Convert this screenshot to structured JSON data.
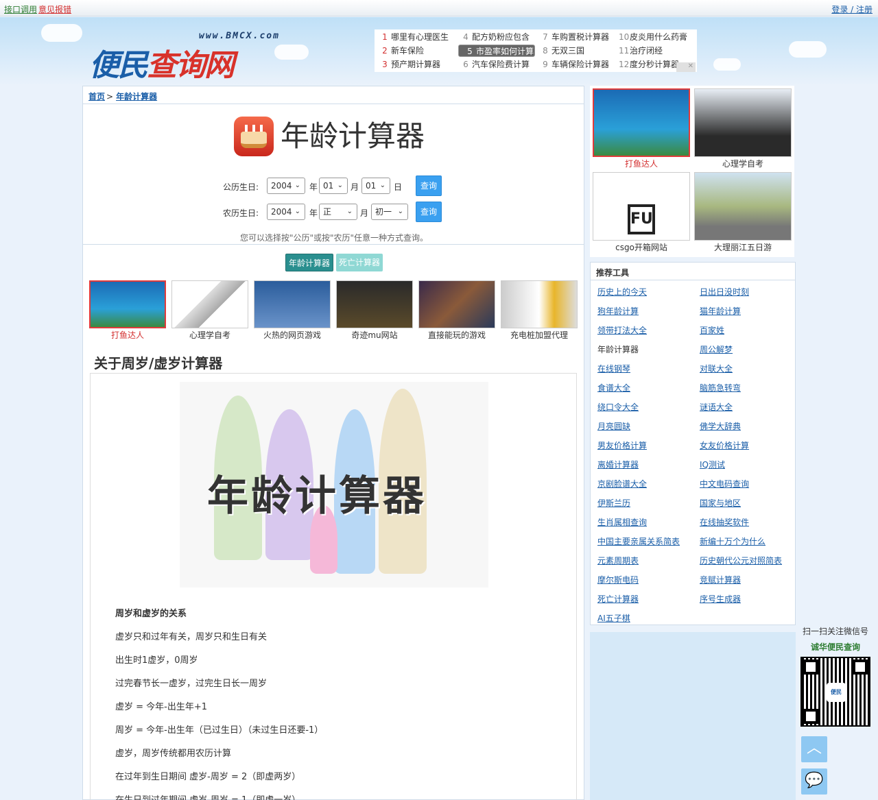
{
  "topbar": {
    "api_link": "接口调用",
    "feedback_link": "意见报错",
    "auth_link": "登录 / 注册"
  },
  "logo": {
    "site": "www.BMCX.com",
    "name_part1": "便民",
    "name_part2": "查询网"
  },
  "hot_list": [
    {
      "n": "1",
      "text": "哪里有心理医生"
    },
    {
      "n": "2",
      "text": "新车保险"
    },
    {
      "n": "3",
      "text": "预产期计算器"
    },
    {
      "n": "4",
      "text": "配方奶粉应包含"
    },
    {
      "n": "5",
      "text": "市盈率如何计算"
    },
    {
      "n": "6",
      "text": "汽车保险费计算"
    },
    {
      "n": "7",
      "text": "车购置税计算器"
    },
    {
      "n": "8",
      "text": "无双三国"
    },
    {
      "n": "9",
      "text": "车辆保险计算器"
    },
    {
      "n": "10",
      "text": "皮炎用什么药膏"
    },
    {
      "n": "11",
      "text": "治疗闭经"
    },
    {
      "n": "12",
      "text": "度分秒计算器"
    }
  ],
  "breadcrumb": {
    "home": "首页",
    "sep": ">",
    "current": "年龄计算器"
  },
  "page_title": "年龄计算器",
  "solar": {
    "label": "公历生日:",
    "year": "2004",
    "year_unit": "年",
    "month": "01",
    "month_unit": "月",
    "day": "01",
    "day_unit": "日",
    "button": "查询"
  },
  "lunar": {
    "label": "农历生日:",
    "year": "2004",
    "year_unit": "年",
    "month": "正",
    "month_unit": "月",
    "day": "初一",
    "button": "查询"
  },
  "hint": "您可以选择按\"公历\"或按\"农历\"任意一种方式查询。",
  "tabs": {
    "age": "年龄计算器",
    "death": "死亡计算器"
  },
  "ads": [
    "打鱼达人",
    "心理学自考",
    "火热的网页游戏",
    "奇迹mu网站",
    "直接能玩的游戏",
    "充电桩加盟代理"
  ],
  "section_title": "关于周岁/虚岁计算器",
  "hero_text": "年龄计算器",
  "article": [
    "周岁和虚岁的关系",
    "虚岁只和过年有关，周岁只和生日有关",
    "出生时1虚岁，0周岁",
    "过完春节长一虚岁，过完生日长一周岁",
    "虚岁 = 今年-出生年+1",
    "周岁 = 今年-出生年（已过生日）（未过生日还要-1）",
    "虚岁，周岁传统都用农历计算",
    "在过年到生日期间 虚岁-周岁 = 2（即虚两岁）",
    "在生日到过年期间 虚岁-周岁 = 1（即虚一岁）"
  ],
  "right_ads": [
    "打鱼达人",
    "心理学自考",
    "csgo开箱网站",
    "大理丽江五日游"
  ],
  "tools_header": "推荐工具",
  "tools": [
    [
      "历史上的今天",
      "日出日没时刻"
    ],
    [
      "狗年龄计算",
      "猫年龄计算"
    ],
    [
      "领带打法大全",
      "百家姓"
    ],
    [
      "年龄计算器",
      "周公解梦"
    ],
    [
      "在线钢琴",
      "对联大全"
    ],
    [
      "食谱大全",
      "脑筋急转弯"
    ],
    [
      "绕口令大全",
      "谜语大全"
    ],
    [
      "月亮圆缺",
      "佛学大辞典"
    ],
    [
      "男友价格计算",
      "女友价格计算"
    ],
    [
      "离婚计算器",
      "IQ测试"
    ],
    [
      "京剧脸谱大全",
      "中文电码查询"
    ],
    [
      "伊斯兰历",
      "国家与地区"
    ],
    [
      "生肖属相查询",
      "在线抽奖软件"
    ],
    [
      "中国主要亲属关系简表",
      "新编十万个为什么"
    ],
    [
      "元素周期表",
      "历史朝代公元对照简表"
    ],
    [
      "摩尔斯电码",
      "竞赋计算器"
    ],
    [
      "死亡计算器",
      "序号生成器"
    ],
    [
      "AI五子棋",
      ""
    ]
  ],
  "qr": {
    "line1": "扫一扫关注微信号",
    "line2": "诚华便民查询",
    "badge": "便民"
  }
}
